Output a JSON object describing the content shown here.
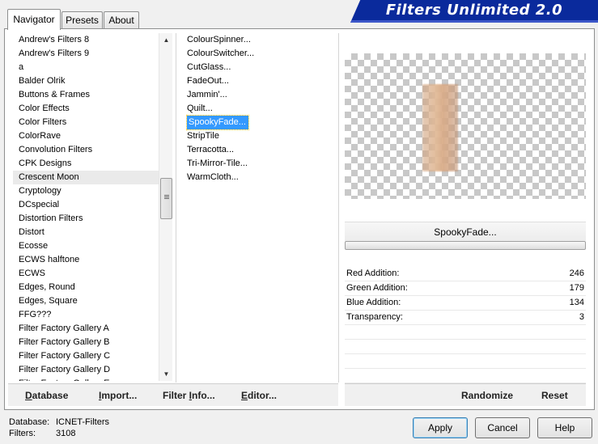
{
  "tabs": [
    "Navigator",
    "Presets",
    "About"
  ],
  "banner_title": "Filters Unlimited 2.0",
  "categories": [
    "Andrew's Filters 8",
    "Andrew's Filters 9",
    "a",
    "Balder Olrik",
    "Buttons & Frames",
    "Color Effects",
    "Color Filters",
    "ColorRave",
    "Convolution Filters",
    "CPK Designs",
    "Crescent Moon",
    "Cryptology",
    "DCspecial",
    "Distortion Filters",
    "Distort",
    "Ecosse",
    "ECWS halftone",
    "ECWS",
    "Edges, Round",
    "Edges, Square",
    "FFG???",
    "Filter Factory Gallery A",
    "Filter Factory Gallery B",
    "Filter Factory Gallery C",
    "Filter Factory Gallery D",
    "Filter Factory Gallery E"
  ],
  "selected_category": "Crescent Moon",
  "filters": [
    "ColourSpinner...",
    "ColourSwitcher...",
    "CutGlass...",
    "FadeOut...",
    "Jammin'...",
    "Quilt...",
    "SpookyFade...",
    "StripTile",
    "Terracotta...",
    "Tri-Mirror-Tile...",
    "WarmCloth..."
  ],
  "selected_filter": "SpookyFade...",
  "preview": {
    "filter_name": "SpookyFade..."
  },
  "params": [
    {
      "label": "Red Addition:",
      "value": "246"
    },
    {
      "label": "Green Addition:",
      "value": "179"
    },
    {
      "label": "Blue Addition:",
      "value": "134"
    },
    {
      "label": "Transparency:",
      "value": "3"
    }
  ],
  "toolbar": {
    "database": "Database",
    "import": "Import...",
    "filter_info": "Filter Info...",
    "editor": "Editor...",
    "randomize": "Randomize",
    "reset": "Reset"
  },
  "footer": {
    "database_label": "Database:",
    "database_value": "ICNET-Filters",
    "filters_label": "Filters:",
    "filters_value": "3108"
  },
  "buttons": {
    "apply": "Apply",
    "cancel": "Cancel",
    "help": "Help"
  }
}
